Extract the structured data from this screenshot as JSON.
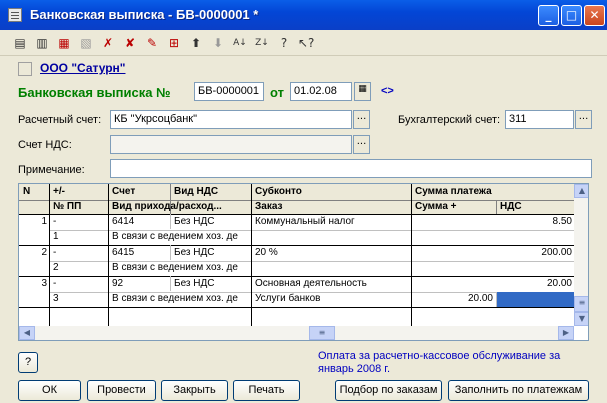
{
  "window": {
    "title": "Банковская выписка - БВ-0000001 *"
  },
  "header": {
    "org_link": "ООО \"Сатурн\"",
    "doc_label": "Банковская выписка №",
    "doc_number": "БВ-0000001",
    "from_label": "от",
    "doc_date": "01.02.08",
    "nav_icon": "<>"
  },
  "form": {
    "account_label": "Расчетный счет:",
    "account_value": "КБ \"Укрсоцбанк\"",
    "ledger_label": "Бухгалтерский счет:",
    "ledger_value": "311",
    "vat_label": "Счет НДС:",
    "vat_value": "",
    "note_label": "Примечание:",
    "note_value": ""
  },
  "table": {
    "headers": {
      "n": "N",
      "sign": "+/-",
      "pp": "№ ПП",
      "account": "Счет",
      "vat_type": "Вид НДС",
      "income_type": "Вид прихода/расход...",
      "subconto": "Субконто",
      "order": "Заказ",
      "payment_sum": "Сумма платежа",
      "sum_plus": "Сумма +",
      "vat": "НДС"
    },
    "rows": [
      {
        "n": "1",
        "sign": "-",
        "pp": "1",
        "account": "6414",
        "vat_type": "Без НДС",
        "income": "В связи с ведением хоз. де",
        "subconto": "Коммунальный налог",
        "order": "",
        "sum": "8.50",
        "sum_plus": "",
        "vat": ""
      },
      {
        "n": "2",
        "sign": "-",
        "pp": "2",
        "account": "6415",
        "vat_type": "Без НДС",
        "income": "В связи с ведением хоз. де",
        "subconto": "20 %",
        "order": "",
        "sum": "200.00",
        "sum_plus": "",
        "vat": ""
      },
      {
        "n": "3",
        "sign": "-",
        "pp": "3",
        "account": "92",
        "vat_type": "Без НДС",
        "income": "В связи с ведением хоз. де",
        "subconto": "Основная деятельность",
        "order": "Услуги банков",
        "sum": "20.00",
        "sum_plus": "20.00",
        "vat": ""
      }
    ]
  },
  "status": {
    "text": "Оплата за расчетно-кассовое обслуживание за январь 2008 г."
  },
  "buttons": {
    "help": "?",
    "ok": "ОК",
    "post": "Провести",
    "close": "Закрыть",
    "print": "Печать",
    "by_orders": "Подбор по заказам",
    "by_payments": "Заполнить по платежкам"
  },
  "colors": {
    "title_bar": "#0a4fe0",
    "header_green": "#008000",
    "link_blue": "#0000a0",
    "selection": "#316ac5"
  }
}
